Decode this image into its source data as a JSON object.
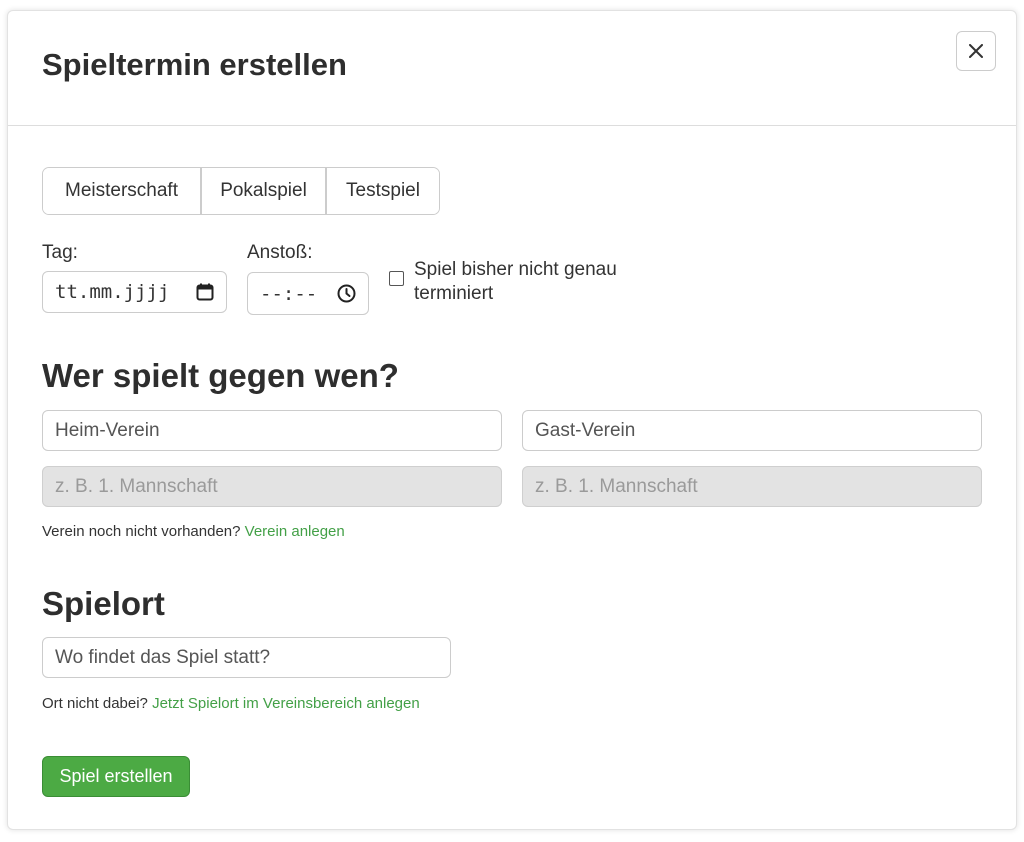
{
  "modal": {
    "title": "Spieltermin erstellen",
    "close_icon": "close-icon"
  },
  "match_type": {
    "options": [
      "Meisterschaft",
      "Pokalspiel",
      "Testspiel"
    ]
  },
  "date": {
    "label": "Tag:",
    "value": "tt.mm.jjjj",
    "icon": "calendar-icon"
  },
  "kickoff": {
    "label": "Anstoß:",
    "value": "--:--",
    "icon": "clock-icon"
  },
  "not_scheduled": {
    "label": "Spiel bisher nicht genau terminiert",
    "checked": false
  },
  "teams": {
    "title": "Wer spielt gegen wen?",
    "home_placeholder": "Heim-Verein",
    "guest_placeholder": "Gast-Verein",
    "home_team_placeholder": "z. B. 1. Mannschaft",
    "guest_team_placeholder": "z. B. 1. Mannschaft",
    "hint_text": "Verein noch nicht vorhanden? ",
    "hint_link": "Verein anlegen"
  },
  "venue": {
    "title": "Spielort",
    "placeholder": "Wo findet das Spiel statt?",
    "hint_text": "Ort nicht dabei? ",
    "hint_link": "Jetzt Spielort im Vereinsbereich anlegen"
  },
  "submit": {
    "label": "Spiel erstellen"
  },
  "colors": {
    "accent": "#4caa44",
    "link": "#43a047",
    "disabled_bg": "#e3e3e3"
  }
}
